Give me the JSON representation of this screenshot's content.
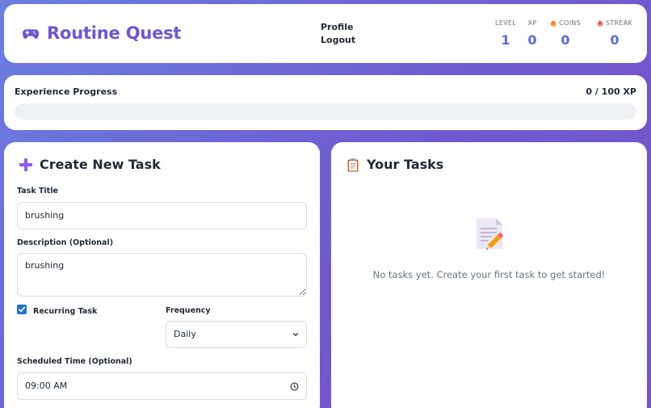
{
  "header": {
    "app_title": "Routine Quest",
    "logo_icon": "gamepad-icon",
    "nav": [
      "Profile",
      "Logout"
    ],
    "stats": [
      {
        "label": "LEVEL",
        "value": "1",
        "icon": ""
      },
      {
        "label": "XP",
        "value": "0",
        "icon": ""
      },
      {
        "label": "COINS",
        "value": "0",
        "icon": "fire-icon"
      },
      {
        "label": "STREAK",
        "value": "0",
        "icon": "fire-icon"
      }
    ]
  },
  "progress": {
    "label": "Experience Progress",
    "value_text": "0 / 100 XP",
    "fraction": 0
  },
  "create_task": {
    "title": "Create New Task",
    "title_icon": "plus-icon",
    "task_title_label": "Task Title",
    "task_title_value": "brushing",
    "description_label": "Description (Optional)",
    "description_value": "brushing",
    "recurring_label": "Recurring Task",
    "recurring_checked": true,
    "frequency_label": "Frequency",
    "frequency_value": "Daily",
    "scheduled_time_label": "Scheduled Time (Optional)",
    "scheduled_time_value": "09:00 AM"
  },
  "your_tasks": {
    "title": "Your Tasks",
    "title_icon": "clipboard-icon",
    "empty_icon": "memo-pencil-icon",
    "empty_text": "No tasks yet. Create your first task to get started!"
  },
  "colors": {
    "accent": "#6d55d6",
    "stat_value": "#5b6ad8",
    "checkbox": "#1f74d0",
    "background_start": "#6a7fe0",
    "background_end": "#7a50c6"
  }
}
